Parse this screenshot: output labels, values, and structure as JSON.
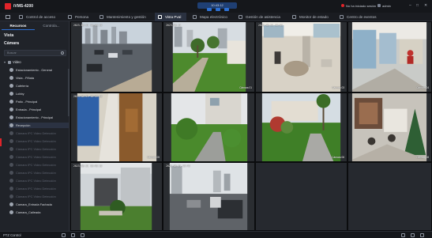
{
  "app": {
    "title": "iVMS-4200"
  },
  "clock": {
    "text": "10:43:12"
  },
  "top_right": {
    "notice": "No ha iniciado sesión",
    "user": "admin"
  },
  "window_controls": {
    "minimize": "–",
    "maximize": "□",
    "close": "✕"
  },
  "tabs": [
    {
      "label": "Control de acceso"
    },
    {
      "label": "Persona"
    },
    {
      "label": "Mantenimiento y gestión"
    },
    {
      "label": "Vista Pval"
    },
    {
      "label": "Mapa electrónico"
    },
    {
      "label": "Gestión de asistencia"
    },
    {
      "label": "Monitor de estado"
    },
    {
      "label": "Centro de eventos"
    }
  ],
  "active_tab_index": 3,
  "panel": {
    "tabs": [
      {
        "label": "Recursos"
      },
      {
        "label": "Controla..."
      }
    ],
    "section_view": "Vista",
    "section_camera": "Cámara",
    "search_placeholder": "Buscar",
    "root": "Video",
    "cameras": [
      {
        "label": "Estacionamiento - General",
        "state": "online"
      },
      {
        "label": "Vista - Piñata",
        "state": "online"
      },
      {
        "label": "Cafetería",
        "state": "online"
      },
      {
        "label": "Lobby",
        "state": "online"
      },
      {
        "label": "Patio - Principal",
        "state": "online"
      },
      {
        "label": "Entrada - Principal",
        "state": "online"
      },
      {
        "label": "Estacionamiento - Principal",
        "state": "online"
      },
      {
        "label": "Recepción",
        "state": "selected"
      },
      {
        "label": "Cámara IPC Video Detección",
        "state": "offline"
      },
      {
        "label": "Cámara IPC Video Detección",
        "state": "offline"
      },
      {
        "label": "Cámara IPC Video Detección",
        "state": "offline"
      },
      {
        "label": "Cámara IPC Video Detección",
        "state": "offline"
      },
      {
        "label": "Cámara IPC Video Detección",
        "state": "offline"
      },
      {
        "label": "Cámara IPC Video Detección",
        "state": "offline"
      },
      {
        "label": "Cámara IPC Video Detección",
        "state": "offline"
      },
      {
        "label": "Cámara IPC Video Detección",
        "state": "offline"
      },
      {
        "label": "Cámara IPC Video Detección",
        "state": "offline"
      },
      {
        "label": "Camara_Entrada Fachada",
        "state": "online"
      },
      {
        "label": "Camara_Calleada",
        "state": "online"
      }
    ]
  },
  "grid": {
    "cells": [
      {
        "timestamp": "2023-08-21 10:43:12",
        "name": ""
      },
      {
        "timestamp": "2023-08-21",
        "name": "Cámara 01"
      },
      {
        "timestamp": "2023-08-21 10:43",
        "name": "Cámara 03"
      },
      {
        "timestamp": "",
        "name": "Cámara 04"
      },
      {
        "timestamp": "2023-08-21 10:43:12",
        "name": "Cámara 05"
      },
      {
        "timestamp": "",
        "name": ""
      },
      {
        "timestamp": "",
        "name": "Cámara 06"
      },
      {
        "timestamp": "",
        "name": "Cámara 08"
      },
      {
        "timestamp": "2023-08-21 10:43:12",
        "name": ""
      },
      {
        "timestamp": "2023-08-21 10:43",
        "name": ""
      },
      {
        "timestamp": "",
        "name": ""
      },
      {
        "timestamp": "",
        "name": ""
      }
    ]
  },
  "bottom": {
    "ptz_label": "PTZ Control"
  }
}
